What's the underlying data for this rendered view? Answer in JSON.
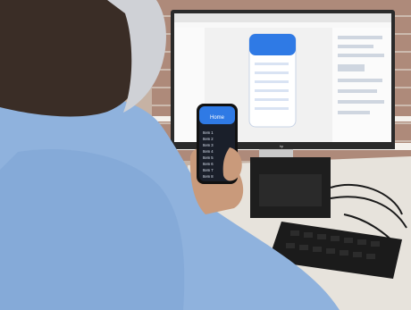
{
  "scene": {
    "description_free": true,
    "colors": {
      "wall_brick": "#9b6a58",
      "wall_mortar": "#c9b7aa",
      "shirt_blue": "#8fb2dd",
      "shirt_shadow": "#6f95c6",
      "hair": "#3a2d26",
      "skin": "#c99a7b",
      "desk": "#e7e3dc",
      "monitor_frame": "#2a2a2a",
      "browser_bg": "#f1f1f1",
      "app_blue": "#2f7ae5",
      "keyboard": "#1b1b1b",
      "pc_tower": "#1e1e1e"
    },
    "phone_app": {
      "header_title": "Home",
      "list_items": [
        "Item 1",
        "Item 2",
        "Item 3",
        "Item 4",
        "Item 5",
        "Item 6",
        "Item 7",
        "Item 8"
      ]
    },
    "monitor_brand": "hp"
  }
}
